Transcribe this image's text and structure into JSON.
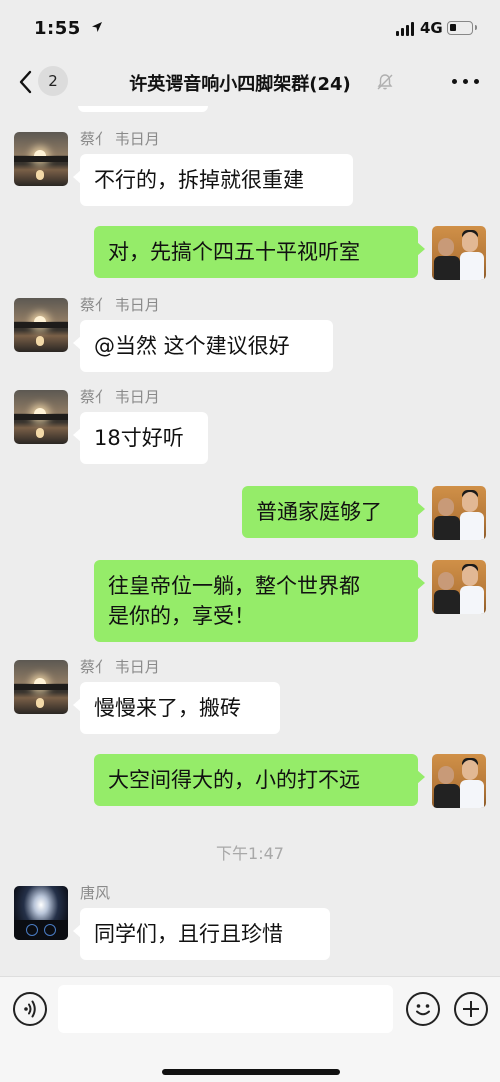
{
  "status_bar": {
    "time": "1:55",
    "network": "4G",
    "battery_level": 0.3,
    "icons": [
      "location-arrow-icon",
      "signal-bars-icon",
      "battery-icon"
    ]
  },
  "nav": {
    "back_badge": "2",
    "title": "许英谔音响小四脚架群(24)",
    "icons": [
      "chevron-left-icon",
      "mute-bell-icon",
      "more-dots-icon"
    ]
  },
  "messages": [
    {
      "side": "left",
      "sender": "蔡亻 韦日月",
      "avatar": "sunset-avatar",
      "text": "不行的，拆掉就很重建"
    },
    {
      "side": "right",
      "avatar": "people-avatar",
      "text": "对，先搞个四五十平视听室"
    },
    {
      "side": "left",
      "sender": "蔡亻 韦日月",
      "avatar": "sunset-avatar",
      "text": "@当然 这个建议很好"
    },
    {
      "side": "left",
      "sender": "蔡亻 韦日月",
      "avatar": "sunset-avatar",
      "text": "18寸好听"
    },
    {
      "side": "right",
      "avatar": "people-avatar",
      "text": "普通家庭够了"
    },
    {
      "side": "right",
      "avatar": "people-avatar",
      "text": "往皇帝位一躺，整个世界都\n是你的，享受！"
    },
    {
      "side": "left",
      "sender": "蔡亻 韦日月",
      "avatar": "sunset-avatar",
      "text": "慢慢来了，搬砖"
    },
    {
      "side": "right",
      "avatar": "people-avatar",
      "text": "大空间得大的，小的打不远"
    },
    {
      "side": "left",
      "sender": "唐风",
      "avatar": "car-avatar",
      "text": "同学们，且行且珍惜"
    }
  ],
  "time_divider": "下午1:47",
  "input_bar": {
    "input_value": "",
    "icons": [
      "voice-icon",
      "emoji-icon",
      "plus-icon"
    ]
  },
  "colors": {
    "background": "#ededed",
    "bubble_self": "#95ec69",
    "bubble_other": "#ffffff"
  }
}
